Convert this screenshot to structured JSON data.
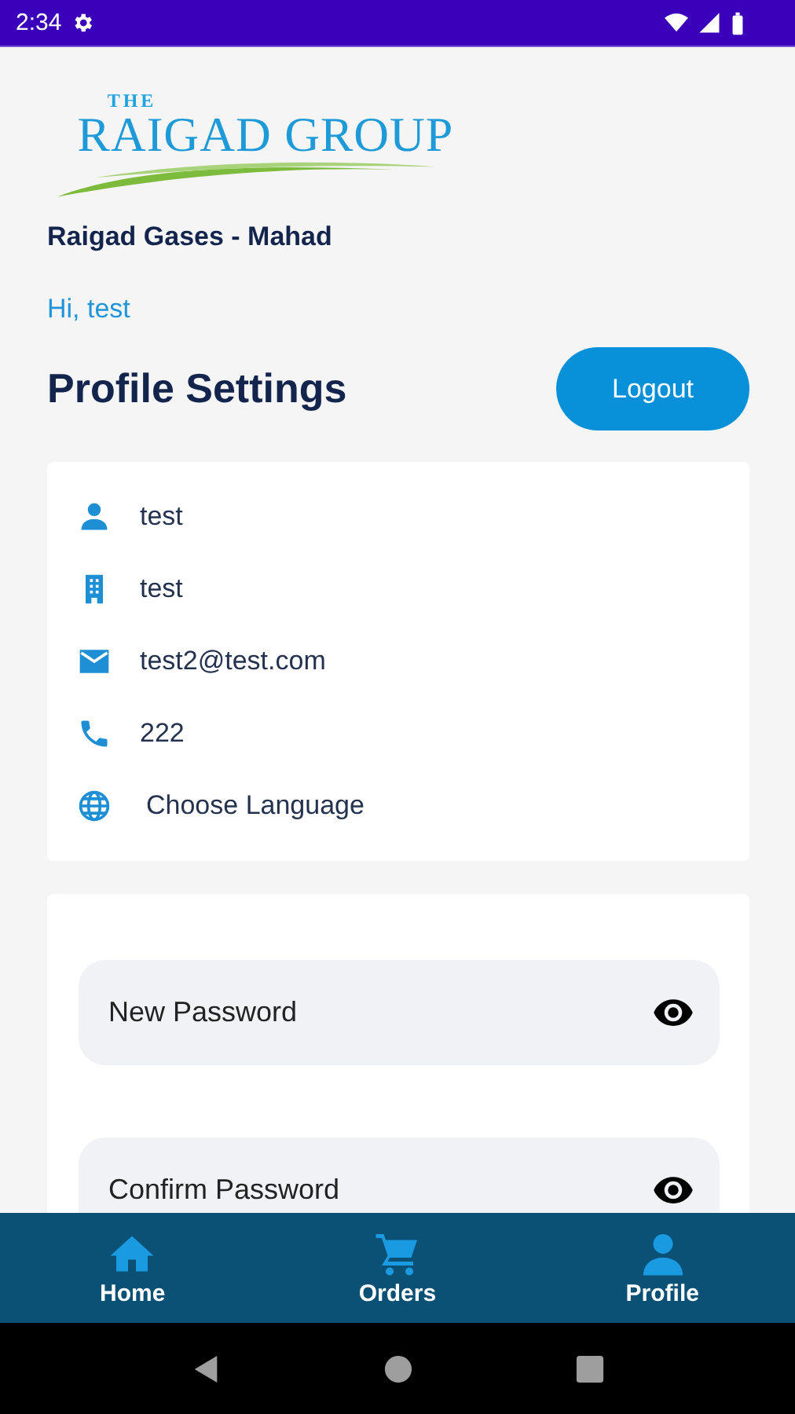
{
  "status_bar": {
    "time": "2:34"
  },
  "logo": {
    "small": "THE",
    "main": "RAIGAD GROUP"
  },
  "company": "Raigad Gases - Mahad",
  "greeting": "Hi, test",
  "title": "Profile Settings",
  "logout_button": "Logout",
  "profile_items": [
    {
      "kind": "person",
      "text": "test"
    },
    {
      "kind": "building",
      "text": "test"
    },
    {
      "kind": "email",
      "text": "test2@test.com"
    },
    {
      "kind": "phone",
      "text": "222"
    },
    {
      "kind": "language",
      "text": "Choose Language"
    }
  ],
  "password_fields": [
    {
      "placeholder": "New Password"
    },
    {
      "placeholder": "Confirm Password"
    }
  ],
  "bottom_nav": [
    {
      "kind": "home",
      "label": "Home"
    },
    {
      "kind": "orders",
      "label": "Orders"
    },
    {
      "kind": "profile",
      "label": "Profile"
    }
  ]
}
